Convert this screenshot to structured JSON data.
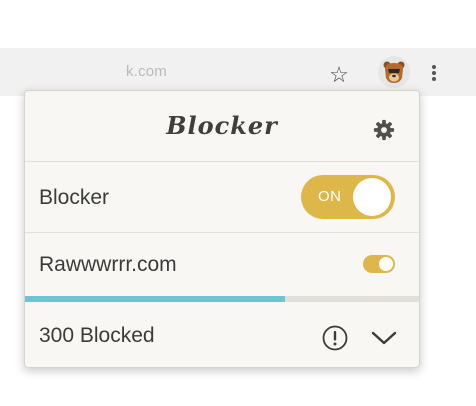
{
  "browser": {
    "address_text": "k.com",
    "star_icon": "star-icon",
    "extension_icon": "bear-icon",
    "menu_icon": "kebab-menu-icon"
  },
  "popup": {
    "logo_text": "Blocker",
    "settings_icon": "gear-icon",
    "master_toggle": {
      "label": "Blocker",
      "state_text": "ON",
      "on": true
    },
    "site_toggle": {
      "label": "Rawwwrrr.com",
      "on": true
    },
    "progress_fraction": 0.66,
    "blocked": {
      "label": "300 Blocked",
      "info_icon": "exclamation-circle-icon",
      "expand_icon": "chevron-down-icon"
    }
  },
  "colors": {
    "accent_gold": "#deb74a",
    "progress_blue": "#70c3d2",
    "panel_bg": "#f8f7f4"
  }
}
